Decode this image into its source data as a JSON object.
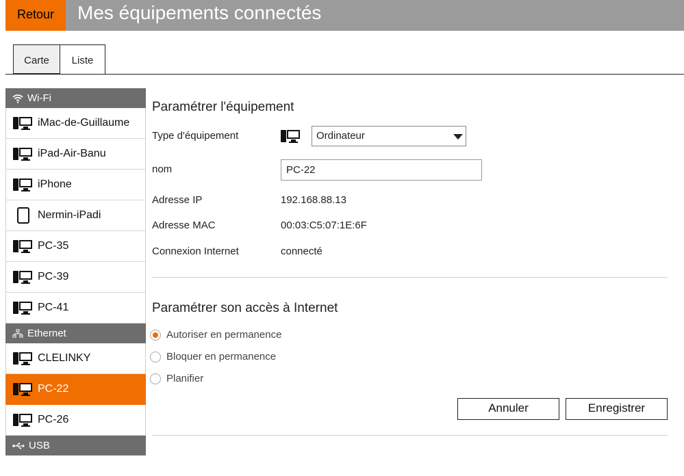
{
  "header": {
    "back_label": "Retour",
    "title": "Mes équipements connectés"
  },
  "tabs": [
    {
      "label": "Carte"
    },
    {
      "label": "Liste",
      "active": true
    }
  ],
  "sidebar": {
    "wifi_label": "Wi-Fi",
    "ethernet_label": "Ethernet",
    "usb_label": "USB",
    "wifi_devices": [
      {
        "label": "iMac-de-Guillaume",
        "icon": "computer-icon"
      },
      {
        "label": "iPad-Air-Banu",
        "icon": "computer-icon"
      },
      {
        "label": "iPhone",
        "icon": "computer-icon"
      },
      {
        "label": "Nermin-iPadi",
        "icon": "tablet-icon"
      },
      {
        "label": "PC-35",
        "icon": "computer-icon"
      },
      {
        "label": "PC-39",
        "icon": "computer-icon"
      },
      {
        "label": "PC-41",
        "icon": "computer-icon"
      }
    ],
    "ethernet_devices": [
      {
        "label": "CLELINKY",
        "icon": "computer-icon"
      },
      {
        "label": "PC-22",
        "icon": "computer-icon",
        "selected": true
      },
      {
        "label": "PC-26",
        "icon": "computer-icon"
      }
    ]
  },
  "device_settings": {
    "title": "Paramétrer l'équipement",
    "type_label": "Type d'équipement",
    "type_value": "Ordinateur",
    "name_label": "nom",
    "name_value": "PC-22",
    "ip_label": "Adresse IP",
    "ip_value": "192.168.88.13",
    "mac_label": "Adresse MAC",
    "mac_value": "00:03:C5:07:1E:6F",
    "connection_label": "Connexion Internet",
    "connection_value": "connecté"
  },
  "internet_access": {
    "title": "Paramétrer son accès à Internet",
    "options": [
      {
        "label": "Autoriser en permanence",
        "checked": true
      },
      {
        "label": "Bloquer en permanence",
        "checked": false
      },
      {
        "label": "Planifier",
        "checked": false
      }
    ]
  },
  "actions": {
    "cancel_label": "Annuler",
    "save_label": "Enregistrer"
  },
  "colors": {
    "accent": "#f16e00",
    "header_bg": "#9b9b9b",
    "group_bg": "#6d6d6d"
  }
}
